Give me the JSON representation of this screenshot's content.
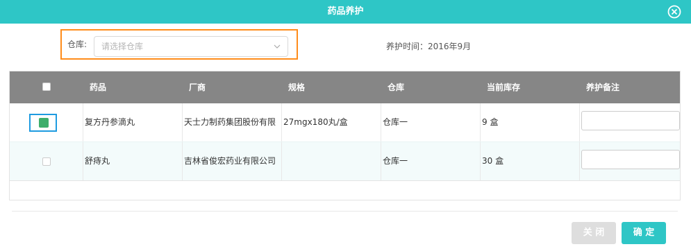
{
  "dialog": {
    "title": "药品养护"
  },
  "warehouse": {
    "label": "仓库:",
    "placeholder": "请选择仓库"
  },
  "maintenance_time": "养护时间：2016年9月",
  "table": {
    "headers": [
      "药品",
      "厂商",
      "规格",
      "仓库",
      "当前库存",
      "养护备注"
    ],
    "rows": [
      {
        "checked": true,
        "drug": "复方丹参滴丸",
        "maker": "天士力制药集团股份有限",
        "spec": "27mgx180丸/盒",
        "warehouse": "仓库一",
        "stock": "9 盒",
        "note": ""
      },
      {
        "checked": false,
        "drug": "舒痔丸",
        "maker": "吉林省俊宏药业有限公司",
        "spec": "",
        "warehouse": "仓库一",
        "stock": "30 盒",
        "note": ""
      }
    ]
  },
  "buttons": {
    "close": "关 闭",
    "confirm": "确 定"
  },
  "colors": {
    "accent": "#2ec6c6",
    "header": "#868686",
    "highlight_orange": "#ff8c1a",
    "highlight_blue": "#1e9be0",
    "checkbox_on": "#3dae6b"
  },
  "icons": {
    "close": "circle-close-icon",
    "dropdown": "chevron-down-icon",
    "check": "checkmark-icon"
  }
}
